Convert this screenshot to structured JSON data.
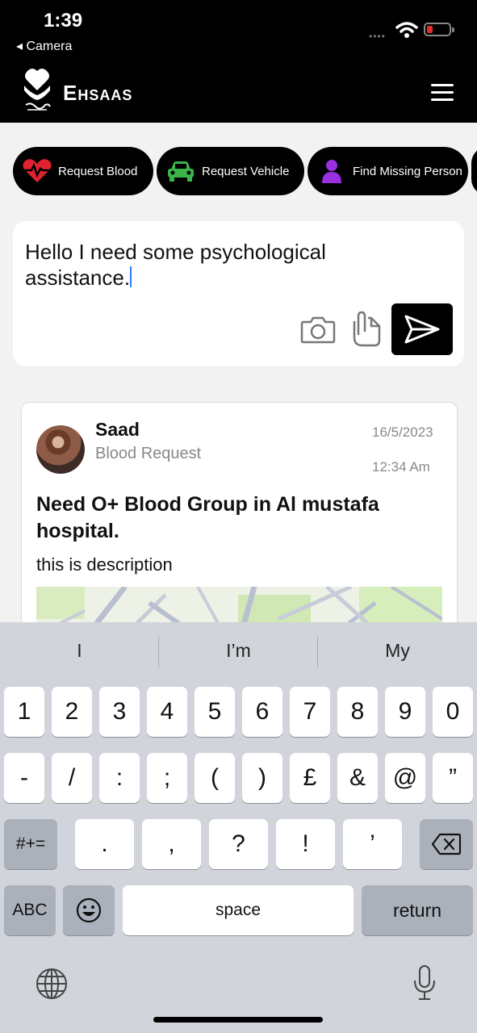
{
  "status": {
    "time": "1:39",
    "back_label": "◂ Camera",
    "dots": "••••"
  },
  "header": {
    "title": "Ehsaas"
  },
  "chips": [
    {
      "label": "Request Blood",
      "icon": "heart-pulse-icon",
      "color": "#e0222e"
    },
    {
      "label": "Request Vehicle",
      "icon": "car-icon",
      "color": "#3bb54a"
    },
    {
      "label": "Find Missing Person",
      "icon": "person-icon",
      "color": "#9b30e0"
    }
  ],
  "compose": {
    "text": "Hello I need some psychological assistance."
  },
  "post": {
    "user": "Saad",
    "type": "Blood Request",
    "date": "16/5/2023",
    "time": "12:34 Am",
    "title": "Need O+ Blood Group in  Al mustafa hospital.",
    "description": "this is description"
  },
  "keyboard": {
    "suggestions": [
      "I",
      "I’m",
      "My"
    ],
    "row1": [
      "1",
      "2",
      "3",
      "4",
      "5",
      "6",
      "7",
      "8",
      "9",
      "0"
    ],
    "row2": [
      "-",
      "/",
      ":",
      ";",
      "(",
      ")",
      "£",
      "&",
      "@",
      "”"
    ],
    "row3_left": "#+=",
    "row3": [
      ".",
      ",",
      "?",
      "!",
      "’"
    ],
    "abc": "ABC",
    "space": "space",
    "return": "return"
  }
}
